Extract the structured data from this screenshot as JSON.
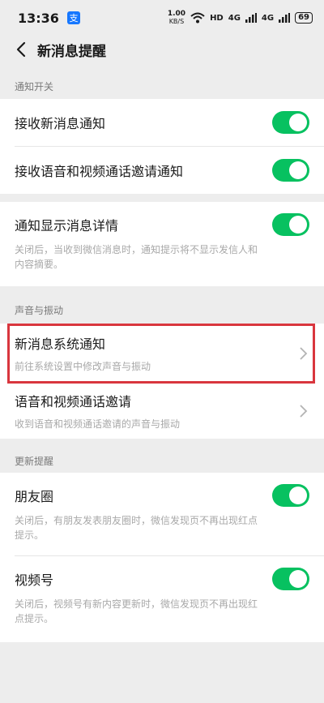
{
  "status": {
    "time": "13:36",
    "app_badge": "支",
    "net_speed_value": "1.00",
    "net_speed_unit": "KB/S",
    "hd": "HD",
    "sig1": "4G",
    "sig2": "4G",
    "battery": "69"
  },
  "nav": {
    "title": "新消息提醒"
  },
  "sections": {
    "notify_switch": "通知开关",
    "sound_vibration": "声音与振动",
    "update_reminder": "更新提醒"
  },
  "rows": {
    "receive_msg": {
      "label": "接收新消息通知",
      "on": true
    },
    "receive_call": {
      "label": "接收语音和视频通话邀请通知",
      "on": true
    },
    "show_detail": {
      "label": "通知显示消息详情",
      "sub": "关闭后，当收到微信消息时，通知提示将不显示发信人和内容摘要。",
      "on": true
    },
    "system_notify": {
      "label": "新消息系统通知",
      "sub": "前往系统设置中修改声音与振动"
    },
    "call_invite": {
      "label": "语音和视频通话邀请",
      "sub": "收到语音和视频通话邀请的声音与振动"
    },
    "moments": {
      "label": "朋友圈",
      "sub": "关闭后，有朋友发表朋友圈时，微信发现页不再出现红点提示。",
      "on": true
    },
    "channels": {
      "label": "视频号",
      "sub": "关闭后，视频号有新内容更新时，微信发现页不再出现红点提示。",
      "on": true
    }
  },
  "colors": {
    "toggle_on": "#07c160",
    "highlight": "#d9363e",
    "bg": "#ededed"
  }
}
